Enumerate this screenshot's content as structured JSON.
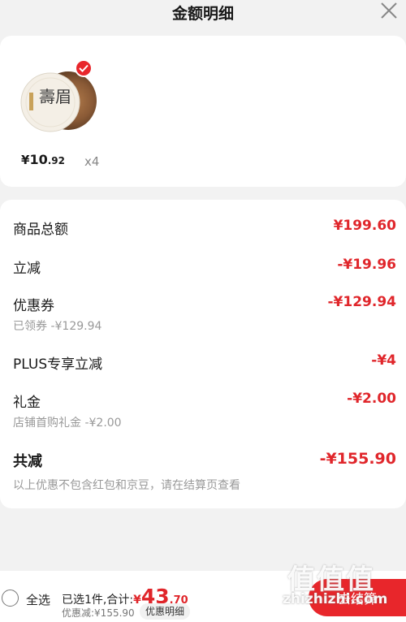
{
  "header": {
    "title": "金额明细"
  },
  "product": {
    "image_text": "壽眉",
    "price_symbol": "¥",
    "price_int": "10",
    "price_dec": ".92",
    "quantity": "x4",
    "selected": true
  },
  "details": {
    "goods_total": {
      "label": "商品总额",
      "value": "¥199.60"
    },
    "instant_discount": {
      "label": "立减",
      "value": "-¥19.96"
    },
    "coupon": {
      "label": "优惠券",
      "value": "-¥129.94",
      "sub": "已领券 -¥129.94"
    },
    "plus_discount": {
      "label": "PLUS专享立减",
      "value": "-¥4"
    },
    "gift_money": {
      "label": "礼金",
      "value": "-¥2.00",
      "sub": "店铺首购礼金 -¥2.00"
    },
    "total_discount": {
      "label": "共减",
      "value": "-¥155.90",
      "sub": "以上优惠不包含红包和京豆，请在结算页查看"
    }
  },
  "bottom_bar": {
    "select_all_label": "全选",
    "summary_prefix": "已选1件,合计:",
    "total_symbol": "¥",
    "total_int": "43",
    "total_dec": ".70",
    "discount_text": "优惠减:¥155.90",
    "detail_link_label": "优惠明细",
    "checkout_label": "去结算"
  },
  "watermark": {
    "logo": "值值值",
    "text": "zhizhizhi.com"
  },
  "colors": {
    "accent_red": "#e8262b",
    "value_red": "#e0262b",
    "background": "#f2f2f2"
  }
}
